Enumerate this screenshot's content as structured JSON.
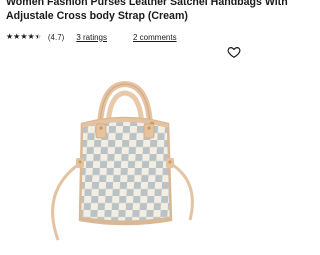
{
  "product": {
    "title_line1": "Women Fashion Purses Leather Satchel Handbags With",
    "title_line2": "Adjustale Cross body Strap (Cream)",
    "rating_value": 4.7,
    "rating_text": "(4.7)",
    "ratings_link": "3 ratings",
    "comments_link": "2 comments"
  },
  "icons": {
    "stars": [
      "star-icon",
      "star-icon",
      "star-icon",
      "star-icon",
      "star-half-icon"
    ],
    "favorite": "heart-outline-icon"
  },
  "colors": {
    "checker_light": "#f3ede2",
    "checker_dark": "#b9c3c7",
    "leather": "#e5c3a0",
    "text": "#1a1a1a"
  }
}
